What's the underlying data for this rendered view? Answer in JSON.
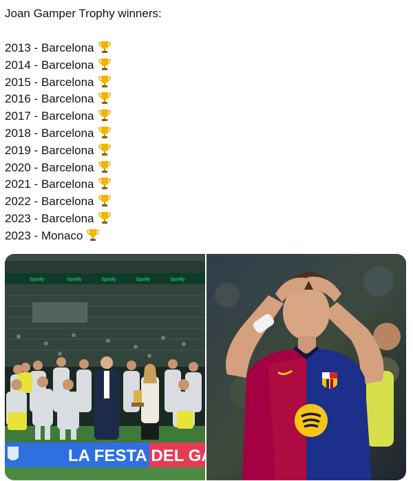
{
  "post": {
    "title": "Joan Gamper Trophy winners:",
    "winners": [
      {
        "year": "2013",
        "team": "Barcelona"
      },
      {
        "year": "2014",
        "team": "Barcelona"
      },
      {
        "year": "2015",
        "team": "Barcelona"
      },
      {
        "year": "2016",
        "team": "Barcelona"
      },
      {
        "year": "2017",
        "team": "Barcelona"
      },
      {
        "year": "2018",
        "team": "Barcelona"
      },
      {
        "year": "2019",
        "team": "Barcelona"
      },
      {
        "year": "2020",
        "team": "Barcelona"
      },
      {
        "year": "2021",
        "team": "Barcelona"
      },
      {
        "year": "2022",
        "team": "Barcelona"
      },
      {
        "year": "2023",
        "team": "Barcelona"
      },
      {
        "year": "2023",
        "team": "Monaco"
      }
    ],
    "separator": " - ",
    "trophy_icon": "trophy-icon"
  },
  "media": {
    "left_banner_text": "LA FESTA DEL GAM",
    "left_sponsor_text": "Spotify"
  },
  "colors": {
    "text": "#0f1419",
    "trophy_gold": "#f4b400",
    "barca_blue": "#1c2f8a",
    "barca_red": "#a50044",
    "banner_blue": "#2f6fe0"
  }
}
